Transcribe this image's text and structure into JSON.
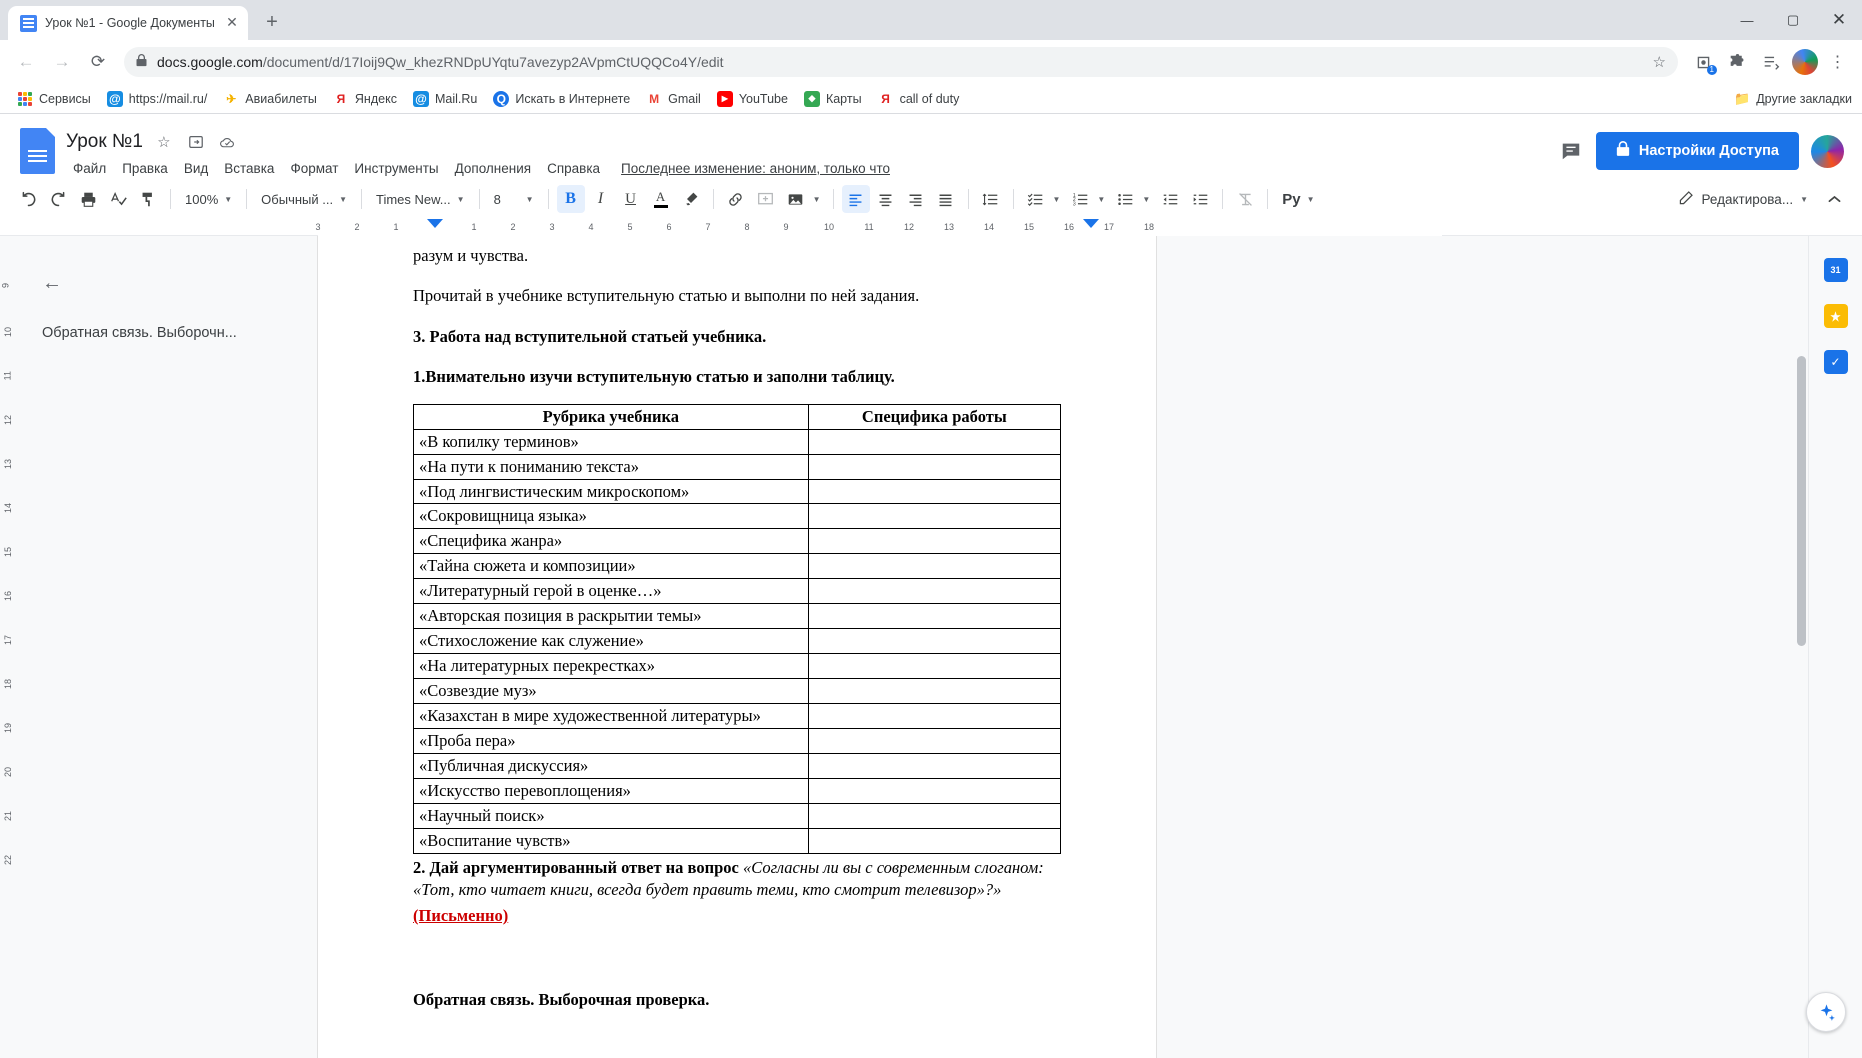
{
  "browser": {
    "tab": {
      "title": "Урок №1 - Google Документы",
      "close_label": "✕",
      "favicon": "google-docs-favicon"
    },
    "newtab_label": "+",
    "window_controls": {
      "minimize": "—",
      "maximize": "▢",
      "close": "✕"
    },
    "nav": {
      "back": "←",
      "forward": "→",
      "reload": "⟳"
    },
    "omnibox": {
      "lock_icon": "🔒",
      "url_host": "docs.google.com",
      "url_path": "/document/d/17Ioij9Qw_khezRNDpUYqtu7avezyp2AVpmCtUQQCo4Y/edit",
      "star_icon": "☆"
    },
    "extensions_badge": "1",
    "bookmarks": [
      {
        "label": "Сервисы",
        "icon": "apps-grid-icon",
        "color": "#4285f4"
      },
      {
        "label": "https://mail.ru/",
        "icon": "mailru-icon",
        "color": "#168de2"
      },
      {
        "label": "Авиабилеты",
        "icon": "plane-icon",
        "color": "#f5c518"
      },
      {
        "label": "Яндекс",
        "icon": "yandex-icon",
        "color": "#e02020"
      },
      {
        "label": "Mail.Ru",
        "icon": "mailru-icon",
        "color": "#168de2"
      },
      {
        "label": "Искать в Интернете",
        "icon": "search-icon",
        "color": "#1a73e8"
      },
      {
        "label": "Gmail",
        "icon": "gmail-icon",
        "color": "#ea4335"
      },
      {
        "label": "YouTube",
        "icon": "youtube-icon",
        "color": "#ff0000"
      },
      {
        "label": "Карты",
        "icon": "maps-icon",
        "color": "#34a853"
      },
      {
        "label": "call of duty",
        "icon": "cod-icon",
        "color": "#e02020"
      }
    ],
    "other_bookmarks": {
      "label": "Другие закладки",
      "icon": "folder-icon"
    }
  },
  "docs": {
    "title": "Урок №1",
    "title_icons": [
      "star-icon",
      "move-to-folder-icon",
      "cloud-saved-icon"
    ],
    "menus": [
      "Файл",
      "Правка",
      "Вид",
      "Вставка",
      "Формат",
      "Инструменты",
      "Дополнения",
      "Справка"
    ],
    "last_edit": "Последнее изменение: аноним, только что",
    "comment_icon": "comment-icon",
    "share_button": {
      "label": "Настройки Доступа",
      "icon": "lock-icon",
      "color": "#1a73e8"
    },
    "avatar": "user-avatar",
    "toolbar": {
      "undo": "↶",
      "redo": "↷",
      "print": "print-icon",
      "spellcheck": "spellcheck-icon",
      "paint_format": "paint-format-icon",
      "zoom": "100%",
      "style": "Обычный ...",
      "font": "Times New...",
      "font_size": "8",
      "bold": "B",
      "italic": "I",
      "underline": "U",
      "text_color": "A",
      "highlight": "highlighter-icon",
      "link": "link-icon",
      "comment_add": "add-comment-icon",
      "image": "image-icon",
      "align_left": "align-left-icon",
      "align_center": "align-center-icon",
      "align_right": "align-right-icon",
      "align_justify": "align-justify-icon",
      "line_spacing": "line-spacing-icon",
      "checklist": "checklist-icon",
      "numbered_list": "numbered-list-icon",
      "bulleted_list": "bulleted-list-icon",
      "indent_decrease": "indent-decrease-icon",
      "indent_increase": "indent-increase-icon",
      "clear_format": "clear-format-icon",
      "input_tools": "Pу",
      "edit_mode": "Редактирова...",
      "collapse": "^"
    },
    "ruler": {
      "marks": [
        "3",
        "2",
        "1",
        "1",
        "2",
        "3",
        "4",
        "5",
        "6",
        "7",
        "8",
        "9",
        "10",
        "11",
        "12",
        "13",
        "14",
        "15",
        "16",
        "17",
        "18"
      ]
    },
    "left_gutter_numbers": [
      "9",
      "10",
      "11",
      "12",
      "13",
      "14",
      "15",
      "16",
      "17",
      "18",
      "19",
      "20",
      "21",
      "22"
    ],
    "outline": {
      "back_icon": "←",
      "item": "Обратная связь. Выборочн..."
    },
    "right_rail": [
      {
        "icon": "calendar-icon",
        "color": "#1a73e8",
        "glyph": "31"
      },
      {
        "icon": "keep-icon",
        "color": "#fbbc04",
        "glyph": ""
      },
      {
        "icon": "tasks-icon",
        "color": "#1a73e8",
        "glyph": "✓"
      }
    ],
    "explore_fab": "explore-icon"
  },
  "document": {
    "para_cut_top": "разум и чувства.",
    "para_read": "Прочитай в учебнике вступительную статью и выполни по ней задания.",
    "heading_3": "3. Работа над вступительной статьей учебника.",
    "task_1": "1.Внимательно изучи вступительную статью и заполни таблицу.",
    "table": {
      "headers": [
        "Рубрика учебника",
        "Специфика работы"
      ],
      "rows": [
        "«В копилку терминов»",
        "«На пути к пониманию текста»",
        "«Под лингвистическим микроскопом»",
        "«Сокровищница языка»",
        "«Специфика жанра»",
        "«Тайна сюжета и композиции»",
        "«Литературный герой в оценке…»",
        "«Авторская позиция в раскрытии темы»",
        "«Стихосложение как служение»",
        "«На литературных перекрестках»",
        "«Созвездие муз»",
        "«Казахстан в мире художественной литературы»",
        "«Проба пера»",
        "«Публичная дискуссия»",
        "«Искусство перевоплощения»",
        "«Научный поиск»",
        "«Воспитание чувств»"
      ]
    },
    "task_2_bold": "2. Дай аргументированный ответ на вопрос",
    "task_2_quote_a": "«Согласны ли вы с современным слоганом:",
    "task_2_quote_b": "«Тот, кто читает книги, всегда будет править теми, кто смотрит телевизор»?»",
    "written_note": "(Письменно)",
    "feedback_heading": "Обратная связь.  Выборочная проверка."
  }
}
